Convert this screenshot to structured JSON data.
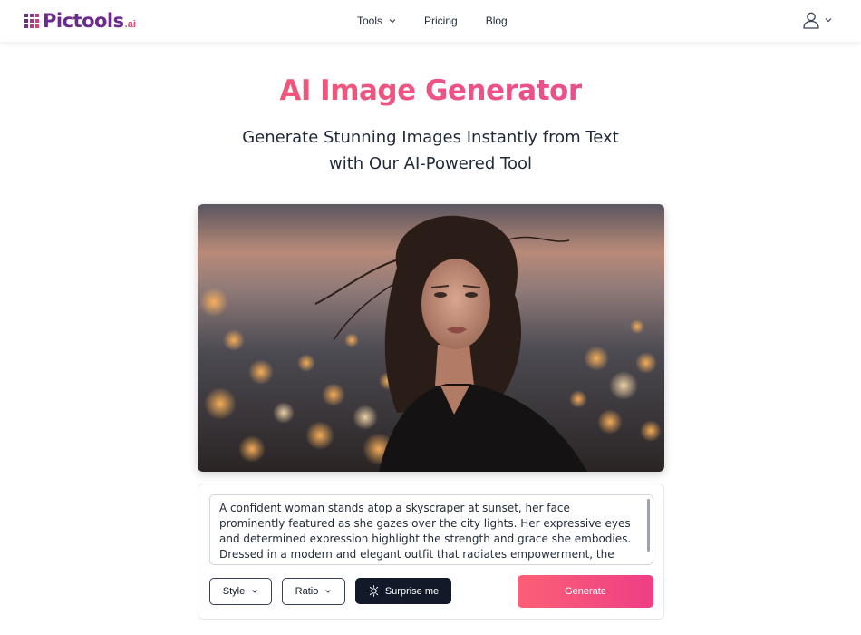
{
  "brand": {
    "name": "Pictools",
    "suffix": ".ai",
    "colors": {
      "purple": "#6b2a8c",
      "pink": "#e4406f"
    }
  },
  "nav": {
    "tools": "Tools",
    "pricing": "Pricing",
    "blog": "Blog"
  },
  "user_menu": {
    "icon": "user-icon"
  },
  "hero": {
    "title": "AI Image Generator",
    "subtitle_line1": "Generate Stunning Images Instantly from Text",
    "subtitle_line2": "with Our AI-Powered Tool"
  },
  "generated_image": {
    "alt": "generated-image"
  },
  "prompt": {
    "value": "A confident woman stands atop a skyscraper at sunset, her face prominently featured as she gazes over the city lights. Her expressive eyes and determined expression highlight the strength and grace she embodies. Dressed in a modern and elegant outfit that radiates empowerment, the wind gently caresses her hair."
  },
  "controls": {
    "style": "Style",
    "ratio": "Ratio",
    "surprise": "Surprise me",
    "generate": "Generate"
  },
  "colors": {
    "accent_start": "#fb6076",
    "accent_end": "#ef3e86",
    "dark_button": "#121a2a"
  }
}
